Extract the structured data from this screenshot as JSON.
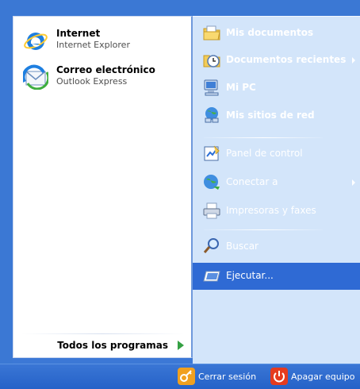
{
  "left": {
    "pinned": [
      {
        "title": "Internet",
        "subtitle": "Internet Explorer",
        "icon": "internet-explorer-icon"
      },
      {
        "title": "Correo electrónico",
        "subtitle": "Outlook Express",
        "icon": "outlook-express-icon"
      }
    ],
    "all_programs": "Todos los programas"
  },
  "right": {
    "items": [
      {
        "label": "Mis documentos",
        "icon": "my-documents-icon"
      },
      {
        "label": "Documentos recientes",
        "icon": "recent-documents-icon"
      },
      {
        "label": "Mi PC",
        "icon": "my-computer-icon"
      },
      {
        "label": "Mis sitios de red",
        "icon": "my-network-places-icon"
      },
      {
        "label": "Panel de control",
        "icon": "control-panel-icon"
      },
      {
        "label": "Conectar a",
        "icon": "connect-to-icon"
      },
      {
        "label": "Impresoras y faxes",
        "icon": "printers-faxes-icon"
      },
      {
        "label": "Buscar",
        "icon": "search-icon"
      },
      {
        "label": "Ejecutar...",
        "icon": "run-icon"
      }
    ]
  },
  "bottom": {
    "logoff": "Cerrar sesión",
    "shutdown": "Apagar equipo"
  },
  "colors": {
    "panel_blue": "#3c78d6",
    "right_panel": "#d3e5fa",
    "highlight": "#2f6ad4",
    "all_programs_arrow": "#34a043"
  }
}
